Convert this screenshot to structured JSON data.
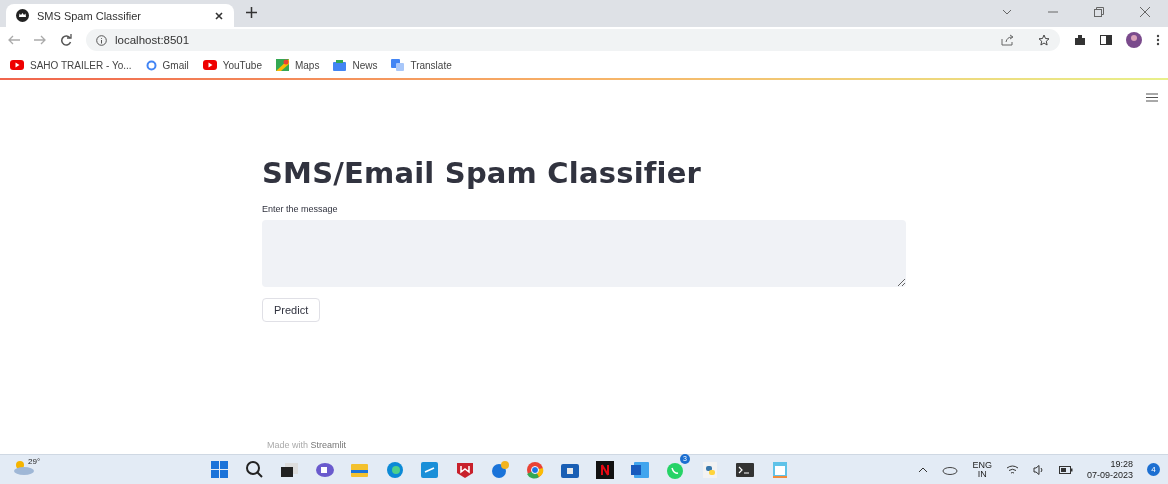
{
  "browser": {
    "tab": {
      "title": "SMS Spam Classifier",
      "selected": true
    },
    "address": "localhost:8501",
    "bookmarks": [
      {
        "label": "SAHO TRAILER - Yo...",
        "kind": "video"
      },
      {
        "label": "Gmail",
        "kind": "g"
      },
      {
        "label": "YouTube",
        "kind": "video"
      },
      {
        "label": "Maps",
        "kind": "maps"
      },
      {
        "label": "News",
        "kind": "news"
      },
      {
        "label": "Translate",
        "kind": "translate"
      }
    ]
  },
  "page": {
    "title": "SMS/Email Spam Classifier",
    "field_label": "Enter the message",
    "button": "Predict",
    "footer_prefix": "Made with",
    "footer_brand": "Streamlit"
  },
  "taskbar": {
    "weather": "29°",
    "chat_badge": "3",
    "language": "ENG",
    "region": "IN",
    "time": "19:28",
    "date": "07-09-2023",
    "notifications": "4"
  }
}
